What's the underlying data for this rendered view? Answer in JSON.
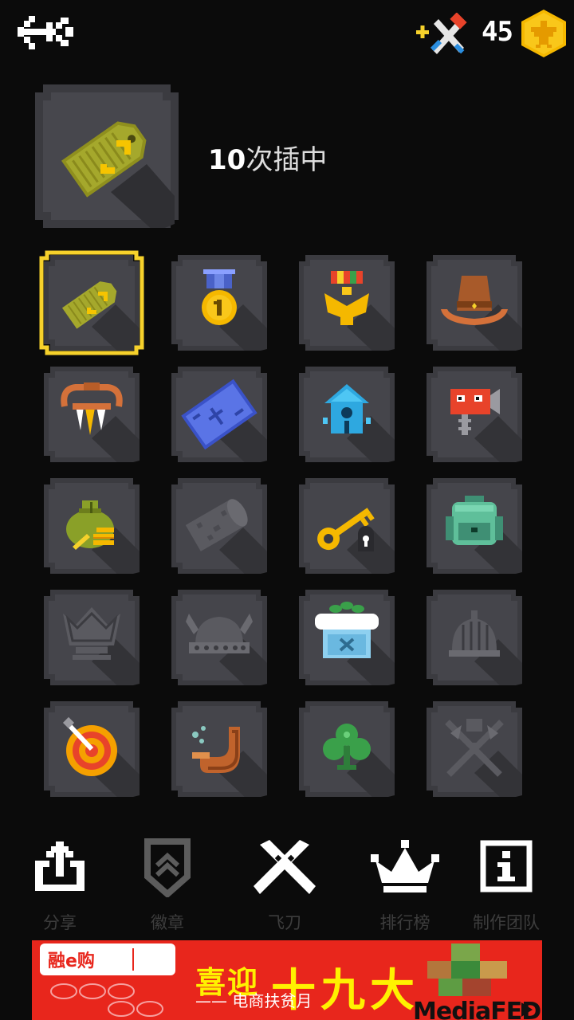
{
  "top_bar": {
    "coin_count": "45",
    "back_icon": "back-arrow-icon",
    "weapons_icon": "add-weapons-icon",
    "coin_icon": "gold-coin-eagle-icon"
  },
  "featured": {
    "count": "10",
    "title": "次插中",
    "icon": "rank-chevron-tag-icon"
  },
  "achievements": [
    {
      "icon": "rank-chevron-tag-icon",
      "selected": true
    },
    {
      "icon": "gold-medal-icon"
    },
    {
      "icon": "eagle-medal-icon"
    },
    {
      "icon": "cowboy-hat-icon"
    },
    {
      "icon": "fang-necklace-icon"
    },
    {
      "icon": "treasure-map-icon"
    },
    {
      "icon": "birdhouse-icon"
    },
    {
      "icon": "robot-camera-icon"
    },
    {
      "icon": "money-bag-icon"
    },
    {
      "icon": "stone-log-locked-icon"
    },
    {
      "icon": "golden-key-icon"
    },
    {
      "icon": "backpack-icon"
    },
    {
      "icon": "crown-locked-icon"
    },
    {
      "icon": "viking-helmet-locked-icon"
    },
    {
      "icon": "flower-shop-icon"
    },
    {
      "icon": "knight-helmet-locked-icon"
    },
    {
      "icon": "dartboard-icon"
    },
    {
      "icon": "smoking-pipe-icon"
    },
    {
      "icon": "clover-icon"
    },
    {
      "icon": "crossed-axes-locked-icon"
    }
  ],
  "nav": {
    "share": "分享",
    "badge": "徽章",
    "knife": "飞刀",
    "leaderboard": "排行榜",
    "credits": "制作团队"
  },
  "ad": {
    "brand": "融e购",
    "slogan_small": "喜迎",
    "slogan_big": "十九大",
    "subtitle": "—— 电商扶贫月",
    "mediafed": "MediaFED"
  },
  "colors": {
    "tile": "#3b3b40",
    "tile_light": "#4e4e54",
    "selected": "#f6d12b",
    "gold": "#f5a800"
  }
}
